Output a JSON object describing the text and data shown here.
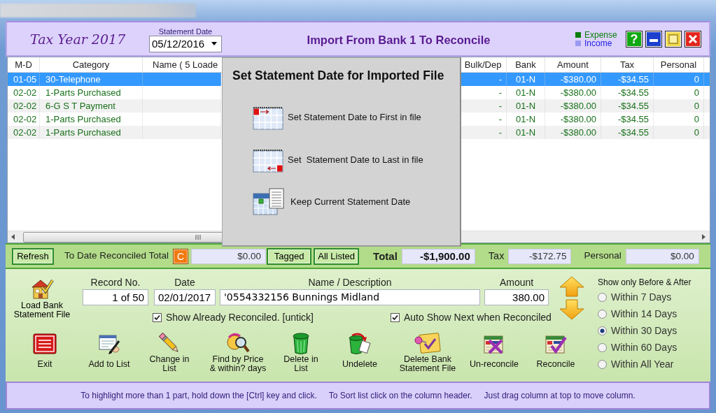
{
  "header": {
    "tax_year": "Tax Year 2017",
    "statement_date": {
      "label": "Statement Date",
      "value": "05/12/2016"
    },
    "title": "Import From Bank 1 To Reconcile",
    "legend": [
      {
        "label": "Expense",
        "color": "#0b7d0b"
      },
      {
        "label": "Income",
        "color": "#9a9af2"
      }
    ],
    "window_buttons": [
      {
        "kind": "help",
        "label": "?"
      },
      {
        "kind": "minimize"
      },
      {
        "kind": "maximize"
      },
      {
        "kind": "close"
      }
    ]
  },
  "table": {
    "columns": [
      "M-D",
      "Category",
      "Name ( 5 Loade",
      "Bulk/Dep",
      "Bank",
      "Amount",
      "Tax",
      "Personal"
    ],
    "rows": [
      {
        "selected": true,
        "md": "01-05",
        "category": "30-Telephone",
        "bulk_dep": "-",
        "bank": "01-N",
        "amount": "-$380.00",
        "tax": "-$34.55",
        "personal": "0"
      },
      {
        "selected": false,
        "md": "02-02",
        "category": "1-Parts Purchased",
        "bulk_dep": "-",
        "bank": "01-N",
        "amount": "-$380.00",
        "tax": "-$34.55",
        "personal": "0"
      },
      {
        "selected": false,
        "md": "02-02",
        "category": "6-G S T Payment",
        "bulk_dep": "-",
        "bank": "01-N",
        "amount": "-$380.00",
        "tax": "-$34.55",
        "personal": "0"
      },
      {
        "selected": false,
        "md": "02-02",
        "category": "1-Parts Purchased",
        "bulk_dep": "-",
        "bank": "01-N",
        "amount": "-$380.00",
        "tax": "-$34.55",
        "personal": "0"
      },
      {
        "selected": false,
        "md": "02-02",
        "category": "1-Parts Purchased",
        "bulk_dep": "-",
        "bank": "01-N",
        "amount": "-$380.00",
        "tax": "-$34.55",
        "personal": "0"
      }
    ]
  },
  "dialog": {
    "title": "Set Statement Date for Imported File",
    "options": [
      {
        "kind": "first",
        "label": "Set Statement Date to First in file"
      },
      {
        "kind": "last",
        "label": "Set  Statement Date to Last in file"
      },
      {
        "kind": "keep",
        "label": "Keep Current Statement Date"
      }
    ]
  },
  "totals_bar": {
    "refresh": "Refresh",
    "reconciled": {
      "label": "To Date Reconciled Total",
      "button": "C",
      "value": "$0.00"
    },
    "tagged": "Tagged",
    "all_listed": "All Listed",
    "total": {
      "label": "Total",
      "value": "-$1,900.00"
    },
    "tax": {
      "label": "Tax",
      "value": "-$172.75"
    },
    "personal": {
      "label": "Personal",
      "value": "$0.00"
    }
  },
  "record_form": {
    "load_button": "Load Bank\nStatement File",
    "fields": [
      {
        "label": "Record No.",
        "value": "1 of 50"
      },
      {
        "label": "Date",
        "value": "02/01/2017"
      },
      {
        "label": "Name / Description",
        "value": "'0554332156 Bunnings Midland"
      },
      {
        "label": "Amount",
        "value": "380.00"
      }
    ],
    "checkboxes": [
      {
        "label": "Show Already Reconciled. [untick]",
        "checked": true
      },
      {
        "label": "Auto Show Next when Reconciled",
        "checked": true
      }
    ],
    "actions": [
      {
        "kind": "exit",
        "label": "Exit"
      },
      {
        "kind": "add",
        "label": "Add to List"
      },
      {
        "kind": "change",
        "label": "Change in\nList"
      },
      {
        "kind": "find",
        "label": "Find by Price\n& within? days"
      },
      {
        "kind": "delete",
        "label": "Delete in\nList"
      },
      {
        "kind": "undelete",
        "label": "Undelete"
      },
      {
        "kind": "delete_file",
        "label": "Delete Bank\nStatement File"
      },
      {
        "kind": "unreconcile",
        "label": "Un-reconcile"
      },
      {
        "kind": "reconcile",
        "label": "Reconcile"
      }
    ]
  },
  "date_filter": {
    "title": "Show only Before & After",
    "options": [
      {
        "label": "Within 7 Days",
        "selected": false
      },
      {
        "label": "Within 14 Days",
        "selected": false
      },
      {
        "label": "Within 30 Days",
        "selected": true
      },
      {
        "label": "Within 60 Days",
        "selected": false
      },
      {
        "label": "Within All Year",
        "selected": false
      }
    ]
  },
  "status_bar": {
    "hints": [
      "To highlight more than 1 part, hold down the [Ctrl] key and click.",
      "To Sort list click on the column header.",
      "Just drag column at top to move column."
    ]
  }
}
